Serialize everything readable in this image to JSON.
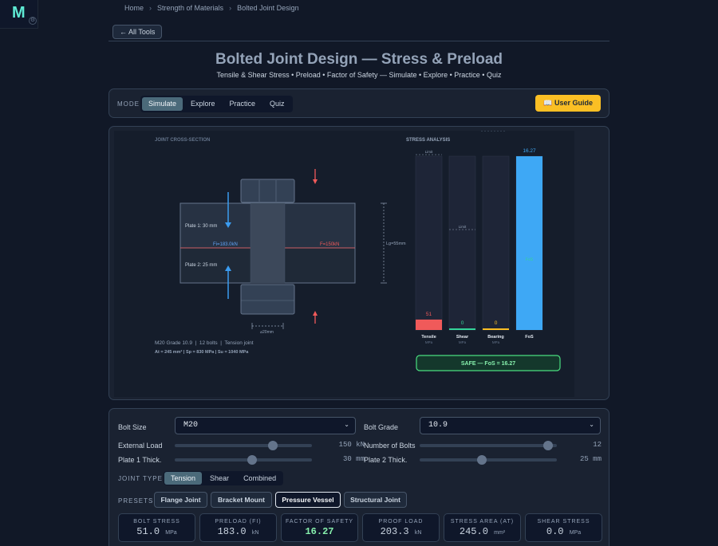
{
  "header": {
    "logo_letter": "M",
    "breadcrumb": [
      "Home",
      "Strength of Materials",
      "Bolted Joint Design"
    ],
    "all_tools_label": "← All Tools"
  },
  "page": {
    "title": "Bolted Joint Design — Stress & Preload",
    "subtitle": "Tensile & Shear Stress • Preload • Factor of Safety — Simulate • Explore • Practice • Quiz"
  },
  "mode": {
    "label": "MODE",
    "tabs": [
      "Simulate",
      "Explore",
      "Practice",
      "Quiz"
    ],
    "active": "Simulate",
    "user_guide_label": "📖 User Guide"
  },
  "simulation": {
    "cross_section_title": "JOINT CROSS-SECTION",
    "plate1_label": "Plate 1: 30 mm",
    "plate2_label": "Plate 2: 25 mm",
    "fi_label": "Fi=183.0kN",
    "f_label": "F=150kN",
    "lg_label": "Lg=55mm",
    "diameter_label": "⌀20mm",
    "spec_line1": "M20 Grade 10.9  |  12 bolts  |  Tension joint",
    "spec_line2": "At = 245 mm²  |  Sp = 830 MPa  |  Su = 1040 MPa",
    "analysis_title": "STRESS ANALYSIS",
    "limit_label": "Limit",
    "bars": [
      {
        "name": "Tensile",
        "unit": "MPa",
        "value_label": "51",
        "fraction": 0.06,
        "color": "#f05a5a"
      },
      {
        "name": "Shear",
        "unit": "MPa",
        "value_label": "0",
        "fraction": 0.0,
        "color": "#34d399"
      },
      {
        "name": "Bearing",
        "unit": "MPa",
        "value_label": "0",
        "fraction": 0.0,
        "color": "#fbbf24"
      },
      {
        "name": "FoS",
        "unit": "",
        "value_label": "16.27",
        "fraction": 1.0,
        "color": "#3ea8f5"
      }
    ],
    "fos_inner_label": "FoS",
    "safe_label": "SAFE — FoS = 16.27"
  },
  "controls": {
    "bolt_size_label": "Bolt Size",
    "bolt_size_value": "M20",
    "bolt_grade_label": "Bolt Grade",
    "bolt_grade_value": "10.9",
    "external_load_label": "External Load",
    "external_load_value": "150 kN",
    "external_load_fraction": 0.73,
    "num_bolts_label": "Number of Bolts",
    "num_bolts_value": "12",
    "num_bolts_fraction": 0.97,
    "plate1_label": "Plate 1 Thick.",
    "plate1_value": "30 mm",
    "plate1_fraction": 0.57,
    "plate2_label": "Plate 2 Thick.",
    "plate2_value": "25 mm",
    "plate2_fraction": 0.45,
    "joint_type_label": "JOINT TYPE",
    "joint_types": [
      "Tension",
      "Shear",
      "Combined"
    ],
    "joint_type_active": "Tension",
    "presets_label": "PRESETS",
    "presets": [
      "Flange Joint",
      "Bracket Mount",
      "Pressure Vessel",
      "Structural Joint"
    ],
    "preset_active": "Pressure Vessel"
  },
  "results": [
    {
      "label": "BOLT STRESS",
      "value": "51.0",
      "unit": "MPa"
    },
    {
      "label": "PRELOAD (FI)",
      "value": "183.0",
      "unit": "kN"
    },
    {
      "label": "FACTOR OF SAFETY",
      "value": "16.27",
      "unit": ""
    },
    {
      "label": "PROOF LOAD",
      "value": "203.3",
      "unit": "kN"
    },
    {
      "label": "STRESS AREA (AT)",
      "value": "245.0",
      "unit": "mm²"
    },
    {
      "label": "SHEAR STRESS",
      "value": "0.0",
      "unit": "MPa"
    }
  ]
}
